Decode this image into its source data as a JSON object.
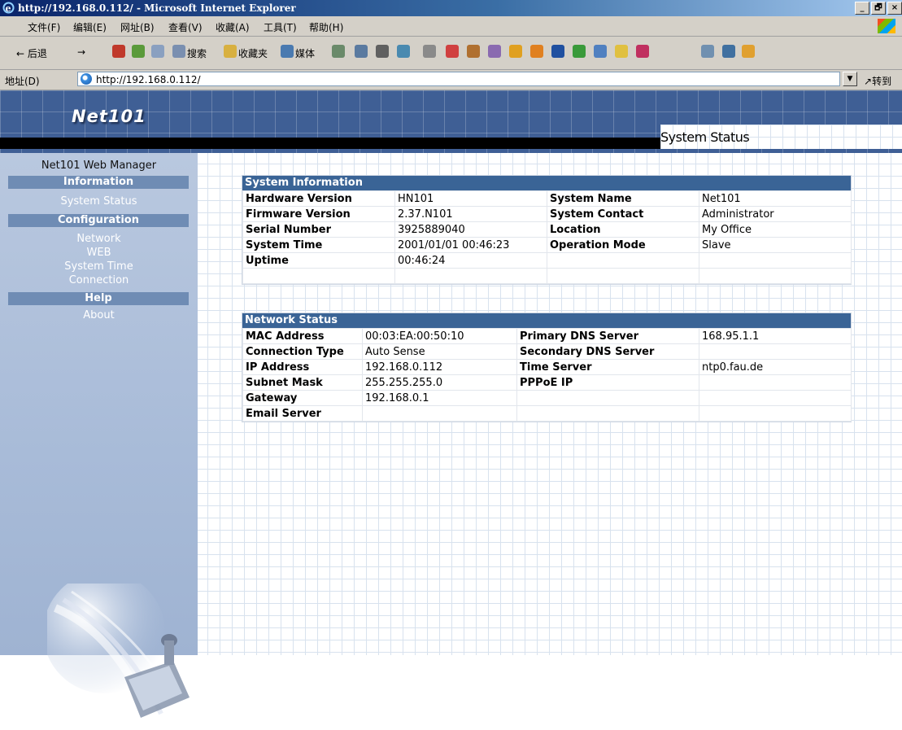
{
  "browser": {
    "window_title": "http://192.168.0.112/ - Microsoft Internet Explorer",
    "window_buttons": [
      "_",
      "🗗",
      "×"
    ],
    "menu": [
      "文件(F)",
      "编辑(E)",
      "网址(B)",
      "查看(V)",
      "收藏(A)",
      "工具(T)",
      "帮助(H)"
    ],
    "toolbar": {
      "back": "← 后退",
      "forward": "→",
      "search": "搜索",
      "favorites": "收藏夹",
      "media": "媒体"
    },
    "address_label": "地址(D)",
    "address_value": "http://192.168.0.112/",
    "go_label": "转到"
  },
  "header": {
    "logo": "Net101",
    "section_title": "System Status"
  },
  "sidebar": {
    "manager_title": "Net101 Web Manager",
    "groups": [
      {
        "title": "Information",
        "items": [
          "System Status"
        ]
      },
      {
        "title": "Configuration",
        "items": [
          "Network",
          "WEB",
          "System Time",
          "Connection"
        ]
      },
      {
        "title": "Help",
        "items": [
          "About"
        ]
      }
    ]
  },
  "system_info": {
    "title": "System Information",
    "rows": [
      [
        "Hardware Version",
        "HN101",
        "System Name",
        "Net101"
      ],
      [
        "Firmware Version",
        "2.37.N101",
        "System Contact",
        "Administrator"
      ],
      [
        "Serial Number",
        "3925889040",
        "Location",
        "My Office"
      ],
      [
        "System Time",
        "2001/01/01 00:46:23",
        "Operation Mode",
        "Slave"
      ],
      [
        "Uptime",
        "00:46:24",
        "",
        ""
      ],
      [
        "",
        "",
        "",
        ""
      ]
    ]
  },
  "network_status": {
    "title": "Network Status",
    "rows": [
      [
        "MAC Address",
        "00:03:EA:00:50:10",
        "Primary DNS Server",
        "168.95.1.1"
      ],
      [
        "Connection Type",
        "Auto Sense",
        "Secondary DNS Server",
        ""
      ],
      [
        "IP Address",
        "192.168.0.112",
        "Time Server",
        "ntp0.fau.de"
      ],
      [
        "Subnet Mask",
        "255.255.255.0",
        "PPPoE IP",
        ""
      ],
      [
        "Gateway",
        "192.168.0.1",
        "",
        ""
      ],
      [
        "Email Server",
        "",
        "",
        ""
      ]
    ]
  },
  "colors": {
    "banner": "#3f5f95",
    "sidebar": "#a8bbd8",
    "group_header": "#3a6496",
    "sidebar_header": "#6f8cb4"
  }
}
